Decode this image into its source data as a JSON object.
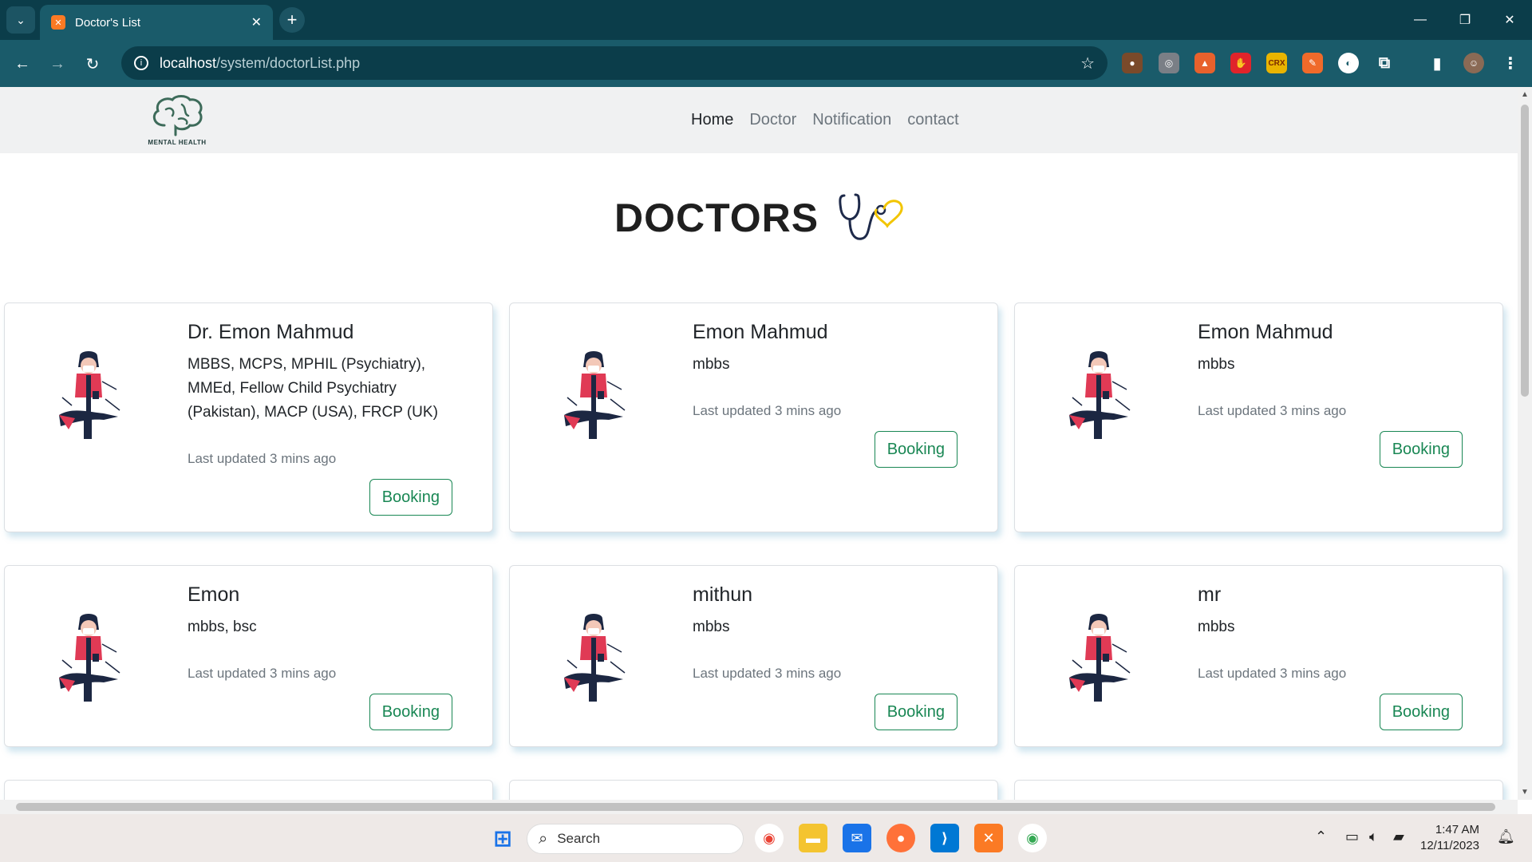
{
  "browser": {
    "tab_title": "Doctor's List",
    "url_host": "localhost",
    "url_path": "/system/doctorList.php"
  },
  "site": {
    "logo_text": "MENTAL HEALTH",
    "nav": [
      {
        "label": "Home",
        "active": true
      },
      {
        "label": "Doctor",
        "active": false
      },
      {
        "label": "Notification",
        "active": false
      },
      {
        "label": "contact",
        "active": false
      }
    ],
    "heading": "DOCTORS"
  },
  "doctors": [
    {
      "name": "Dr. Emon Mahmud",
      "quals": "MBBS, MCPS, MPHIL (Psychiatry), MMEd, Fellow Child Psychiatry (Pakistan), MACP (USA), FRCP (UK)",
      "updated": "Last updated 3 mins ago",
      "button": "Booking"
    },
    {
      "name": "Emon Mahmud",
      "quals": "mbbs",
      "updated": "Last updated 3 mins ago",
      "button": "Booking"
    },
    {
      "name": "Emon Mahmud",
      "quals": "mbbs",
      "updated": "Last updated 3 mins ago",
      "button": "Booking"
    },
    {
      "name": "Emon",
      "quals": "mbbs, bsc",
      "updated": "Last updated 3 mins ago",
      "button": "Booking"
    },
    {
      "name": "mithun",
      "quals": "mbbs",
      "updated": "Last updated 3 mins ago",
      "button": "Booking"
    },
    {
      "name": "mr",
      "quals": "mbbs",
      "updated": "Last updated 3 mins ago",
      "button": "Booking"
    }
  ],
  "taskbar": {
    "search_label": "Search",
    "time": "1:47 AM",
    "date": "12/11/2023"
  },
  "colors": {
    "tabbar": "#0b3d4a",
    "toolbar": "#1a5b6a",
    "booking_green": "#198754",
    "nav_bg": "#f0f1f2"
  }
}
